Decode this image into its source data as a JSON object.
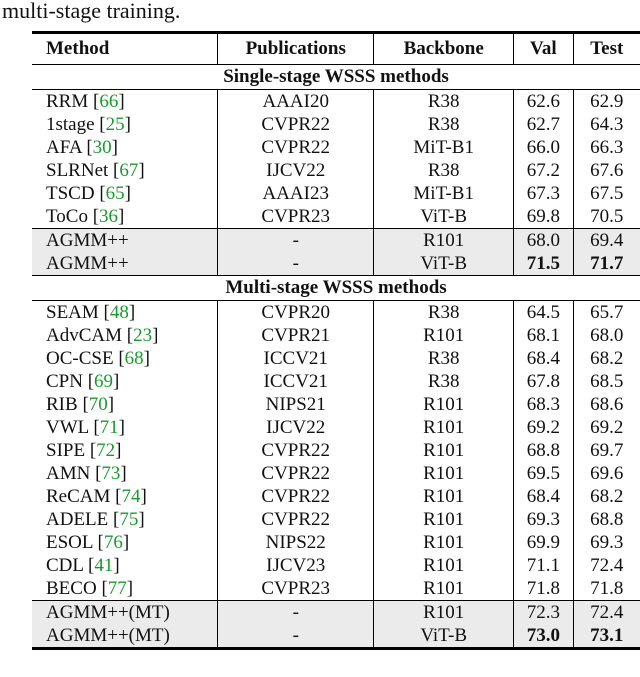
{
  "caption": "multi-stage training.",
  "table": {
    "headers": [
      "Method",
      "Publications",
      "Backbone",
      "Val",
      "Test"
    ],
    "sections": [
      {
        "title": "Single-stage WSSS methods",
        "rows": [
          {
            "method": "RRM",
            "ref": "66",
            "pub": "AAAI20",
            "backbone": "R38",
            "val": "62.6",
            "test": "62.9"
          },
          {
            "method": "1stage",
            "ref": "25",
            "pub": "CVPR22",
            "backbone": "R38",
            "val": "62.7",
            "test": "64.3"
          },
          {
            "method": "AFA",
            "ref": "30",
            "pub": "CVPR22",
            "backbone": "MiT-B1",
            "val": "66.0",
            "test": "66.3"
          },
          {
            "method": "SLRNet",
            "ref": "67",
            "pub": "IJCV22",
            "backbone": "R38",
            "val": "67.2",
            "test": "67.6"
          },
          {
            "method": "TSCD",
            "ref": "65",
            "pub": "AAAI23",
            "backbone": "MiT-B1",
            "val": "67.3",
            "test": "67.5"
          },
          {
            "method": "ToCo",
            "ref": "36",
            "pub": "CVPR23",
            "backbone": "ViT-B",
            "val": "69.8",
            "test": "70.5"
          }
        ],
        "ours": [
          {
            "method": "AGMM++",
            "pub": "-",
            "backbone": "R101",
            "val": "68.0",
            "test": "69.4",
            "bold": false
          },
          {
            "method": "AGMM++",
            "pub": "-",
            "backbone": "ViT-B",
            "val": "71.5",
            "test": "71.7",
            "bold": true
          }
        ]
      },
      {
        "title": "Multi-stage WSSS methods",
        "rows": [
          {
            "method": "SEAM",
            "ref": "48",
            "pub": "CVPR20",
            "backbone": "R38",
            "val": "64.5",
            "test": "65.7"
          },
          {
            "method": "AdvCAM",
            "ref": "23",
            "pub": "CVPR21",
            "backbone": "R101",
            "val": "68.1",
            "test": "68.0"
          },
          {
            "method": "OC-CSE",
            "ref": "68",
            "pub": "ICCV21",
            "backbone": "R38",
            "val": "68.4",
            "test": "68.2"
          },
          {
            "method": "CPN",
            "ref": "69",
            "pub": "ICCV21",
            "backbone": "R38",
            "val": "67.8",
            "test": "68.5"
          },
          {
            "method": "RIB",
            "ref": "70",
            "pub": "NIPS21",
            "backbone": "R101",
            "val": "68.3",
            "test": "68.6"
          },
          {
            "method": "VWL",
            "ref": "71",
            "pub": "IJCV22",
            "backbone": "R101",
            "val": "69.2",
            "test": "69.2"
          },
          {
            "method": "SIPE",
            "ref": "72",
            "pub": "CVPR22",
            "backbone": "R101",
            "val": "68.8",
            "test": "69.7"
          },
          {
            "method": "AMN",
            "ref": "73",
            "pub": "CVPR22",
            "backbone": "R101",
            "val": "69.5",
            "test": "69.6"
          },
          {
            "method": "ReCAM",
            "ref": "74",
            "pub": "CVPR22",
            "backbone": "R101",
            "val": "68.4",
            "test": "68.2"
          },
          {
            "method": "ADELE",
            "ref": "75",
            "pub": "CVPR22",
            "backbone": "R101",
            "val": "69.3",
            "test": "68.8"
          },
          {
            "method": "ESOL",
            "ref": "76",
            "pub": "NIPS22",
            "backbone": "R101",
            "val": "69.9",
            "test": "69.3"
          },
          {
            "method": "CDL",
            "ref": "41",
            "pub": "IJCV23",
            "backbone": "R101",
            "val": "71.1",
            "test": "72.4"
          },
          {
            "method": "BECO",
            "ref": "77",
            "pub": "CVPR23",
            "backbone": "R101",
            "val": "71.8",
            "test": "71.8"
          }
        ],
        "ours": [
          {
            "method": "AGMM++(MT)",
            "pub": "-",
            "backbone": "R101",
            "val": "72.3",
            "test": "72.4",
            "bold": false
          },
          {
            "method": "AGMM++(MT)",
            "pub": "-",
            "backbone": "ViT-B",
            "val": "73.0",
            "test": "73.1",
            "bold": true
          }
        ]
      }
    ]
  }
}
